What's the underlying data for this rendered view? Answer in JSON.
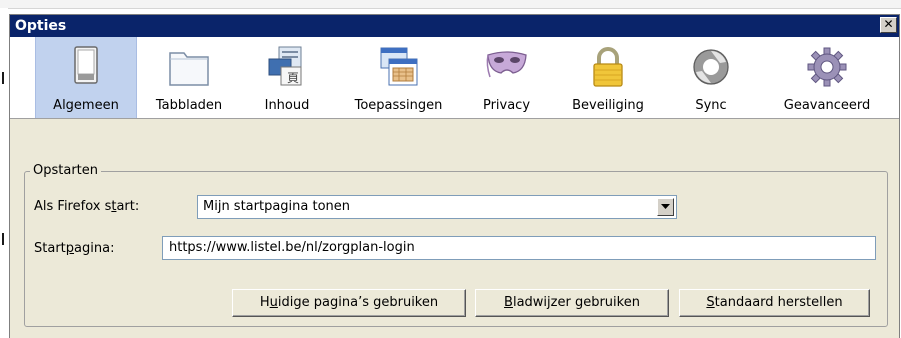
{
  "window": {
    "title": "Opties",
    "close_symbol": "✕"
  },
  "toolbar": {
    "tabs": [
      {
        "label": "Algemeen",
        "icon": "switch-icon",
        "selected": true
      },
      {
        "label": "Tabbladen",
        "icon": "folder-tab-icon"
      },
      {
        "label": "Inhoud",
        "icon": "content-icon"
      },
      {
        "label": "Toepassingen",
        "icon": "applications-icon"
      },
      {
        "label": "Privacy",
        "icon": "mask-icon"
      },
      {
        "label": "Beveiliging",
        "icon": "lock-icon"
      },
      {
        "label": "Sync",
        "icon": "sync-icon"
      },
      {
        "label": "Geavanceerd",
        "icon": "gear-icon"
      }
    ]
  },
  "startup": {
    "group_title": "Opstarten",
    "when_starts_label_pre": "Als Firefox s",
    "when_starts_label_u": "t",
    "when_starts_label_post": "art:",
    "when_starts_value": "Mijn startpagina tonen",
    "homepage_label_pre": "Start",
    "homepage_label_u": "p",
    "homepage_label_post": "agina:",
    "homepage_value": "https://www.listel.be/nl/zorgplan-login",
    "buttons": {
      "current_pre": "H",
      "current_u": "u",
      "current_post": "idige pagina’s gebruiken",
      "bookmark_u": "B",
      "bookmark_post": "ladwijzer gebruiken",
      "restore_u": "S",
      "restore_post": "tandaard herstellen"
    }
  },
  "colors": {
    "titlebar": "#0a246a",
    "selected_tab": "#c1d2ee",
    "dialog_bg": "#ece9d8"
  }
}
